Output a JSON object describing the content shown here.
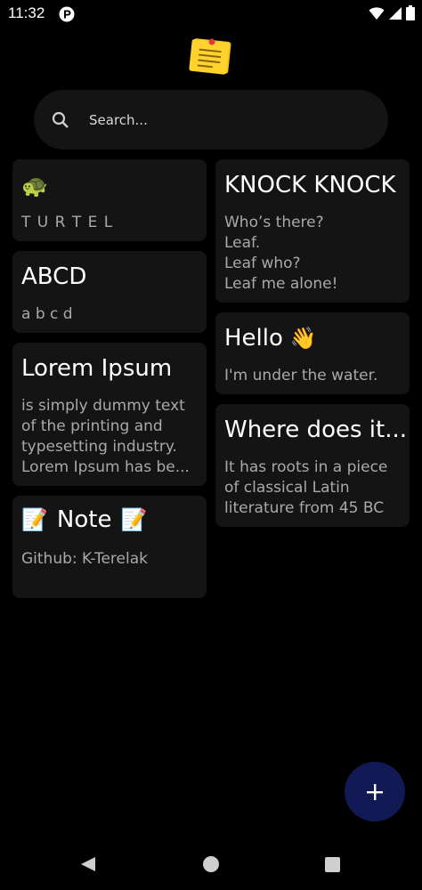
{
  "status_bar": {
    "time": "11:32"
  },
  "search": {
    "placeholder": "Search..."
  },
  "notes": {
    "turtle": {
      "emoji": "🐢",
      "body": "T U R T E L"
    },
    "abcd": {
      "title": "ABCD",
      "body": "a b c d"
    },
    "lorem": {
      "title": "Lorem Ipsum",
      "line1": "is simply dummy text",
      "line2": "of the printing and",
      "line3": "typesetting industry.",
      "line4": "Lorem Ipsum has be..."
    },
    "note": {
      "emoji_left": "📝",
      "title": "Note",
      "emoji_right": "📝",
      "body": "Github: K-Terelak"
    },
    "knock": {
      "title": "KNOCK KNOCK",
      "line1": "Who’s there?",
      "line2": "Leaf.",
      "line3": "Leaf who?",
      "line4": "Leaf me alone!"
    },
    "hello": {
      "title": "Hello",
      "emoji": "👋",
      "body": "I'm under the water."
    },
    "where": {
      "title": "Where does it...",
      "line1": "It has roots in a piece",
      "line2": "of classical Latin",
      "line3": "literature from 45 BC"
    }
  },
  "colors": {
    "background": "#000000",
    "card": "#141414",
    "fab": "#111a55",
    "body_text": "#a9a9a9"
  },
  "icons": {
    "fab": "plus-icon",
    "search": "search-icon",
    "logo": "sticky-note-icon"
  }
}
